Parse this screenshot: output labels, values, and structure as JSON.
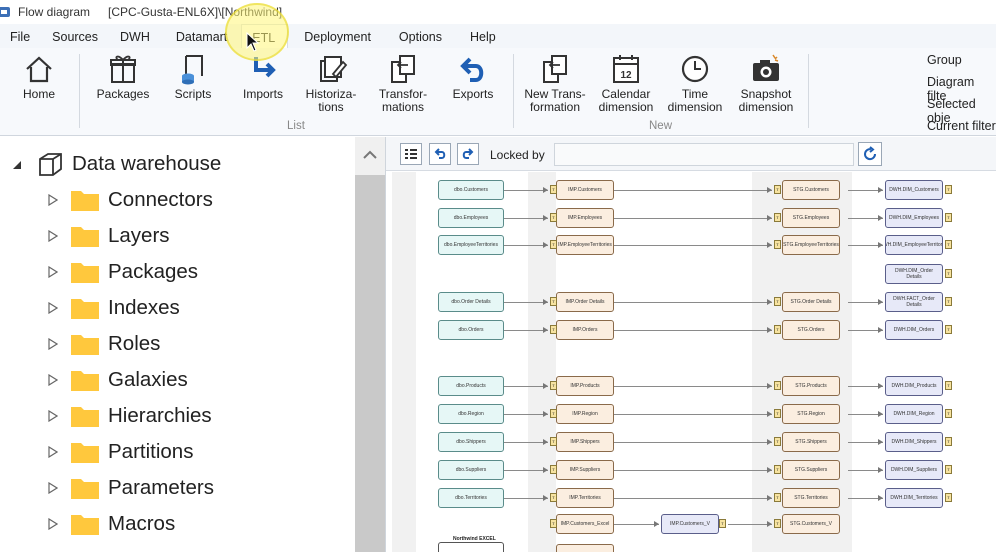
{
  "window": {
    "title": "Flow diagram",
    "subtitle": "[CPC-Gusta-ENL6X]\\[Northwind]"
  },
  "menu": [
    "File",
    "Sources",
    "DWH",
    "Datamart",
    "ETL",
    "Deployment",
    "Options",
    "Help"
  ],
  "ribbon": {
    "home": "Home",
    "list_buttons": [
      "Packages",
      "Scripts",
      "Imports",
      "Historiza-\ntions",
      "Transfor-\nmations",
      "Exports"
    ],
    "list_label": "List",
    "new_buttons": [
      "New Trans-\nformation",
      "Calendar\ndimension",
      "Time\ndimension",
      "Snapshot\ndimension"
    ],
    "new_label": "New",
    "calendar_day": "12",
    "right_items": [
      "Group",
      "Diagram filte",
      "Selected obje",
      "Current filter"
    ]
  },
  "tree": {
    "root": "Data warehouse",
    "children": [
      "Connectors",
      "Layers",
      "Packages",
      "Indexes",
      "Roles",
      "Galaxies",
      "Hierarchies",
      "Partitions",
      "Parameters",
      "Macros"
    ]
  },
  "canvas": {
    "locked_by_label": "Locked by",
    "locked_by_value": "",
    "port_label": "T",
    "rows": [
      {
        "src": "dbo.Customers",
        "imp": "IMP.Customers",
        "stg": "STG.Customers",
        "dwh": "DWH.DIM_Customers"
      },
      {
        "src": "dbo.Employees",
        "imp": "IMP.Employees",
        "stg": "STG.Employees",
        "dwh": "DWH.DIM_Employees"
      },
      {
        "src": "dbo.EmployeeTerritories",
        "imp": "IMP.EmployeeTerritories",
        "stg": "STG.EmployeeTerritories",
        "dwh": "DWH.DIM_EmployeeTerritories"
      },
      {
        "src": "",
        "imp": "",
        "stg": "",
        "dwh": "DWH.DIM_Order Details"
      },
      {
        "src": "dbo.Order Details",
        "imp": "IMP.Order Details",
        "stg": "STG.Order Details",
        "dwh": "DWH.FACT_Order Details"
      },
      {
        "src": "dbo.Orders",
        "imp": "IMP.Orders",
        "stg": "STG.Orders",
        "dwh": "DWH.DIM_Orders"
      },
      {
        "src": "dbo.Products",
        "imp": "IMP.Products",
        "stg": "STG.Products",
        "dwh": "DWH.DIM_Products"
      },
      {
        "src": "dbo.Region",
        "imp": "IMP.Region",
        "stg": "STG.Region",
        "dwh": "DWH.DIM_Region"
      },
      {
        "src": "dbo.Shippers",
        "imp": "IMP.Shippers",
        "stg": "STG.Shippers",
        "dwh": "DWH.DIM_Shippers"
      },
      {
        "src": "dbo.Suppliers",
        "imp": "IMP.Suppliers",
        "stg": "STG.Suppliers",
        "dwh": "DWH.DIM_Suppliers"
      },
      {
        "src": "dbo.Territories",
        "imp": "IMP.Territories",
        "stg": "STG.Territories",
        "dwh": "DWH.DIM_Territories"
      }
    ],
    "excel": {
      "group_label": "Northwind EXCEL",
      "imp": "IMP.Customers_Excel",
      "mid": "IMP.Customers_V",
      "stg": "STG.Customers_V"
    }
  }
}
